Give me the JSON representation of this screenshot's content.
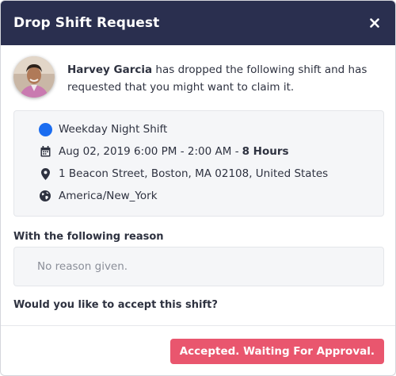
{
  "dialog": {
    "title": "Drop Shift Request",
    "close_icon": "close-icon"
  },
  "requester": {
    "name": "Harvey Garcia",
    "message": " has dropped the following shift and has requested that you might want to claim it."
  },
  "shift": {
    "name": "Weekday Night Shift",
    "color": "#1a6cf0",
    "time": "Aug 02, 2019 6:00 PM - 2:00 AM -",
    "duration": "8 Hours",
    "address": "1 Beacon Street, Boston, MA 02108, United States",
    "timezone": "America/New_York"
  },
  "reason": {
    "label": "With the following reason",
    "text": "No reason given."
  },
  "question": "Would you like to accept this shift?",
  "actions": {
    "accept_label": "Accepted. Waiting For Approval.",
    "accept_color": "#e9566e"
  },
  "colors": {
    "header_bg": "#2a2f4f",
    "card_bg": "#f5f6f8"
  }
}
